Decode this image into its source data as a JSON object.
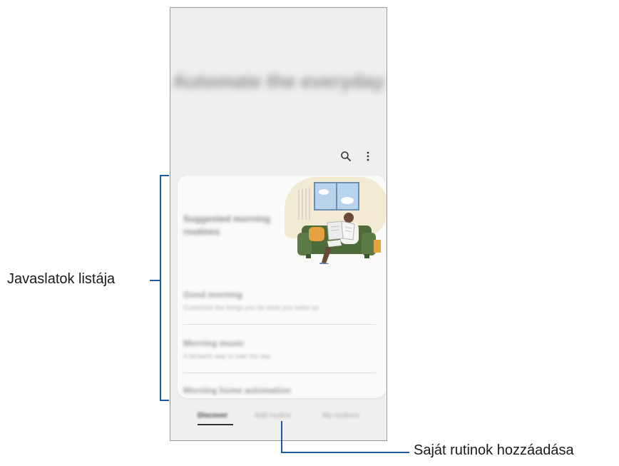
{
  "screen": {
    "title": "Automate the everyday",
    "header_icons": [
      "search-icon",
      "more-options-icon"
    ]
  },
  "suggestions": {
    "card_title": "Suggested morning routines",
    "items": [
      {
        "title": "Good morning",
        "subtitle": "Customize the things you do while you wake up"
      },
      {
        "title": "Morning music",
        "subtitle": "A fantastic way to start the day"
      },
      {
        "title": "Morning home automation",
        "subtitle": ""
      }
    ]
  },
  "bottom_tabs": [
    {
      "label": "Discover",
      "active": true
    },
    {
      "label": "Add routine",
      "active": false
    },
    {
      "label": "My routines",
      "active": false
    }
  ],
  "annotations": {
    "left": "Javaslatok listája",
    "bottom": "Saját rutinok hozzáadása"
  },
  "colors": {
    "callout_line": "#1b5a9e",
    "screen_background": "#efefed",
    "card_background": "#fafaf8",
    "illustration_blob": "#f3ead4",
    "sofa": "#4e6b3a"
  }
}
